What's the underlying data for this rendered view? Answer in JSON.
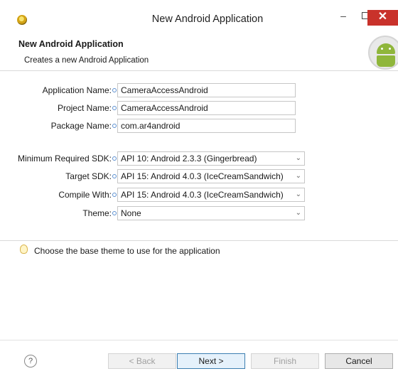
{
  "window": {
    "title": "New Android Application",
    "minimize": "–",
    "close": "✕"
  },
  "header": {
    "title": "New Android Application",
    "subtitle": "Creates a new Android Application"
  },
  "form": {
    "application_name": {
      "label": "Application Name:",
      "value": "CameraAccessAndroid"
    },
    "project_name": {
      "label": "Project Name:",
      "value": "CameraAccessAndroid"
    },
    "package_name": {
      "label": "Package Name:",
      "value": "com.ar4android"
    },
    "min_sdk": {
      "label": "Minimum Required SDK:",
      "value": "API 10: Android 2.3.3 (Gingerbread)"
    },
    "target_sdk": {
      "label": "Target SDK:",
      "value": "API 15: Android 4.0.3 (IceCreamSandwich)"
    },
    "compile_with": {
      "label": "Compile With:",
      "value": "API 15: Android 4.0.3 (IceCreamSandwich)"
    },
    "theme": {
      "label": "Theme:",
      "value": "None"
    }
  },
  "hint": {
    "text": "Choose the base theme to use for the application",
    "icon": "lightbulb-icon"
  },
  "footer": {
    "help": "?",
    "back": "< Back",
    "next": "Next >",
    "finish": "Finish",
    "cancel": "Cancel"
  },
  "colors": {
    "close_button": "#c9322b",
    "android_green": "#8fb63b",
    "info_dot": "#5b8fd0"
  }
}
